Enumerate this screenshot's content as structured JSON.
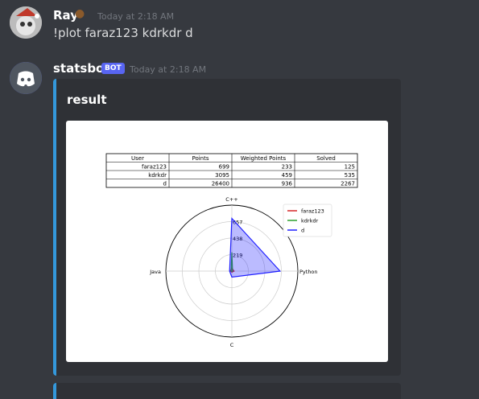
{
  "messages": [
    {
      "author": "Ray",
      "timestamp": "Today at 2:18 AM",
      "content": "!plot faraz123 kdrkdr d"
    },
    {
      "author": "statsbot",
      "badge": "BOT",
      "timestamp": "Today at 2:18 AM",
      "embed": {
        "title": "result",
        "accent_color": "#3498db"
      }
    }
  ],
  "chart_data": {
    "type": "table",
    "columns": [
      "User",
      "Points",
      "Weighted Points",
      "Solved"
    ],
    "rows": [
      [
        "faraz123",
        "699",
        "233",
        "125"
      ],
      [
        "kdrkdr",
        "3095",
        "459",
        "535"
      ],
      [
        "d",
        "26400",
        "936",
        "2267"
      ]
    ],
    "radar": {
      "type": "radar",
      "axes": [
        "C++",
        "Python",
        "C",
        "Java"
      ],
      "rticks": [
        "219",
        "438",
        "657"
      ],
      "rmax": 876,
      "series": [
        {
          "name": "faraz123",
          "color": "#d62728",
          "values": [
            40,
            30,
            15,
            20
          ]
        },
        {
          "name": "kdrkdr",
          "color": "#2ca02c",
          "values": [
            250,
            10,
            5,
            10
          ]
        },
        {
          "name": "d",
          "color": "#1f1fff",
          "values": [
            700,
            640,
            80,
            30
          ]
        }
      ],
      "legend_position": "top-right",
      "grid": true
    }
  }
}
